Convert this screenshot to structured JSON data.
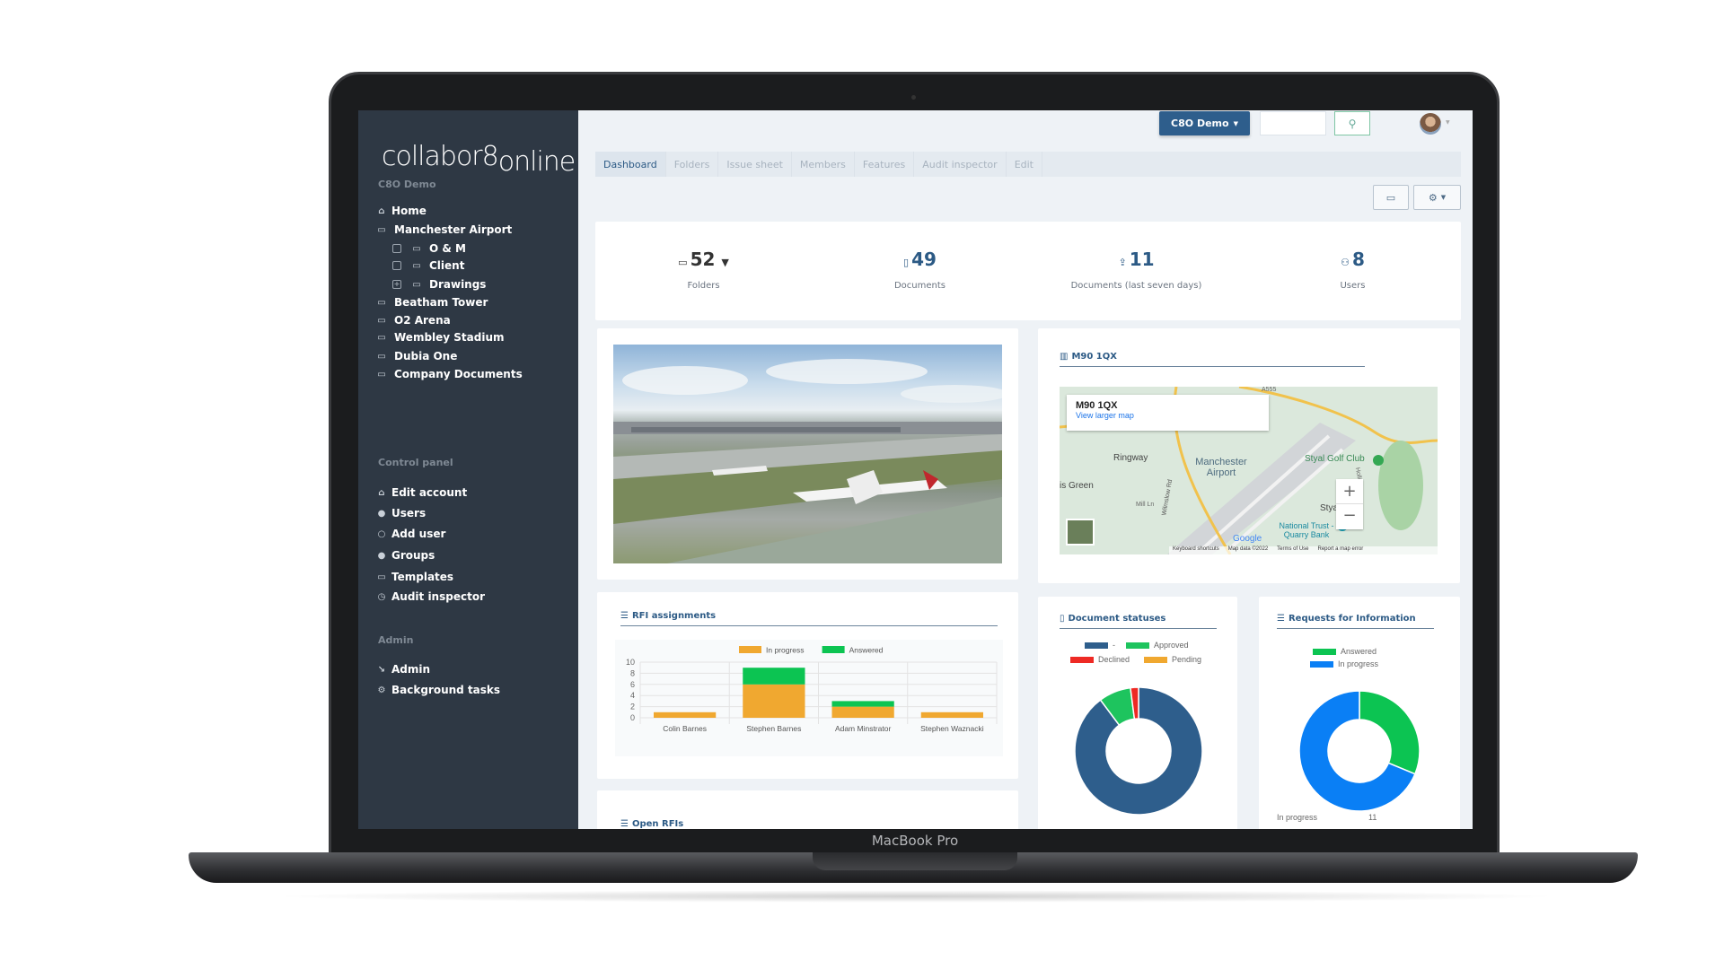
{
  "device": {
    "brand": "MacBook Pro"
  },
  "sidebar": {
    "logo": "collabor8online",
    "section_project": "C8O Demo",
    "home": "Home",
    "projects": [
      {
        "label": "Manchester Airport",
        "icon": "briefcase-icon",
        "children": [
          {
            "label": "O & M",
            "expander": ""
          },
          {
            "label": "Client",
            "expander": ""
          },
          {
            "label": "Drawings",
            "expander": "+"
          }
        ]
      },
      {
        "label": "Beatham Tower",
        "icon": "briefcase-icon"
      },
      {
        "label": "O2 Arena",
        "icon": "briefcase-icon"
      },
      {
        "label": "Wembley Stadium",
        "icon": "briefcase-icon"
      },
      {
        "label": "Dubia One",
        "icon": "briefcase-icon"
      },
      {
        "label": "Company Documents",
        "icon": "folder-icon"
      }
    ],
    "section_control": "Control panel",
    "control_items": [
      {
        "label": "Edit account",
        "icon": "home-outline-icon"
      },
      {
        "label": "Users",
        "icon": "user-icon"
      },
      {
        "label": "Add user",
        "icon": "add-user-icon"
      },
      {
        "label": "Groups",
        "icon": "group-icon"
      },
      {
        "label": "Templates",
        "icon": "folder-icon"
      },
      {
        "label": "Audit inspector",
        "icon": "clock-icon"
      }
    ],
    "section_admin": "Admin",
    "admin_items": [
      {
        "label": "Admin",
        "icon": "wrench-icon"
      },
      {
        "label": "Background tasks",
        "icon": "tasks-icon"
      }
    ]
  },
  "header": {
    "project_button": "C8O Demo",
    "search_placeholder": ""
  },
  "tabs": [
    "Dashboard",
    "Folders",
    "Issue sheet",
    "Members",
    "Features",
    "Audit inspector",
    "Edit"
  ],
  "active_tab": "Dashboard",
  "stats": [
    {
      "value": "52",
      "label": "Folders",
      "icon": "folder-icon"
    },
    {
      "value": "49",
      "label": "Documents",
      "icon": "document-icon"
    },
    {
      "value": "11",
      "label": "Documents (last seven days)",
      "icon": "upload-icon"
    },
    {
      "value": "8",
      "label": "Users",
      "icon": "users-icon"
    }
  ],
  "map": {
    "title": "M90 1QX",
    "popup_title": "M90 1QX",
    "popup_link": "View larger map",
    "labels": [
      "Ringway",
      "Manchester Airport",
      "Styal Golf Club",
      "Styal",
      "National Trust - Quarry Bank",
      "is Green",
      "Wilmslow Rd",
      "Mill Ln",
      "Hollin Ln",
      "A555"
    ],
    "google": "Google",
    "footer": [
      "Keyboard shortcuts",
      "Map data ©2022",
      "Terms of Use",
      "Report a map error"
    ],
    "zoom_in": "+",
    "zoom_out": "−"
  },
  "open_rfis": {
    "title": "Open RFIs"
  },
  "chart_data": [
    {
      "type": "bar",
      "title": "RFI assignments",
      "stacked": true,
      "categories": [
        "Colin Barnes",
        "Stephen Barnes",
        "Adam Minstrator",
        "Stephen Waznacki"
      ],
      "series": [
        {
          "name": "In progress",
          "values": [
            1,
            6,
            2,
            1
          ],
          "color": "#f0a830"
        },
        {
          "name": "Answered",
          "values": [
            0,
            3,
            1,
            0
          ],
          "color": "#0cc452"
        }
      ],
      "ylim": [
        0,
        10
      ],
      "yticks": [
        "0",
        "2",
        "4",
        "6",
        "8",
        "10"
      ],
      "grid": true,
      "legend": "top"
    },
    {
      "type": "pie",
      "donut": true,
      "title": "Document statuses",
      "categories": [
        "-",
        "Approved",
        "Declined",
        "Pending"
      ],
      "values": [
        44,
        4,
        1,
        0
      ],
      "colors": [
        "#2e5e8c",
        "#1ec45e",
        "#ee2a24",
        "#f0a830"
      ],
      "legend": "top"
    },
    {
      "type": "pie",
      "donut": true,
      "title": "Requests for Information",
      "categories": [
        "Answered",
        "In progress"
      ],
      "values": [
        5,
        11
      ],
      "colors": [
        "#0cc452",
        "#0a7ff5"
      ],
      "legend": "top",
      "footer_label": "In progress",
      "footer_value": "11"
    }
  ]
}
